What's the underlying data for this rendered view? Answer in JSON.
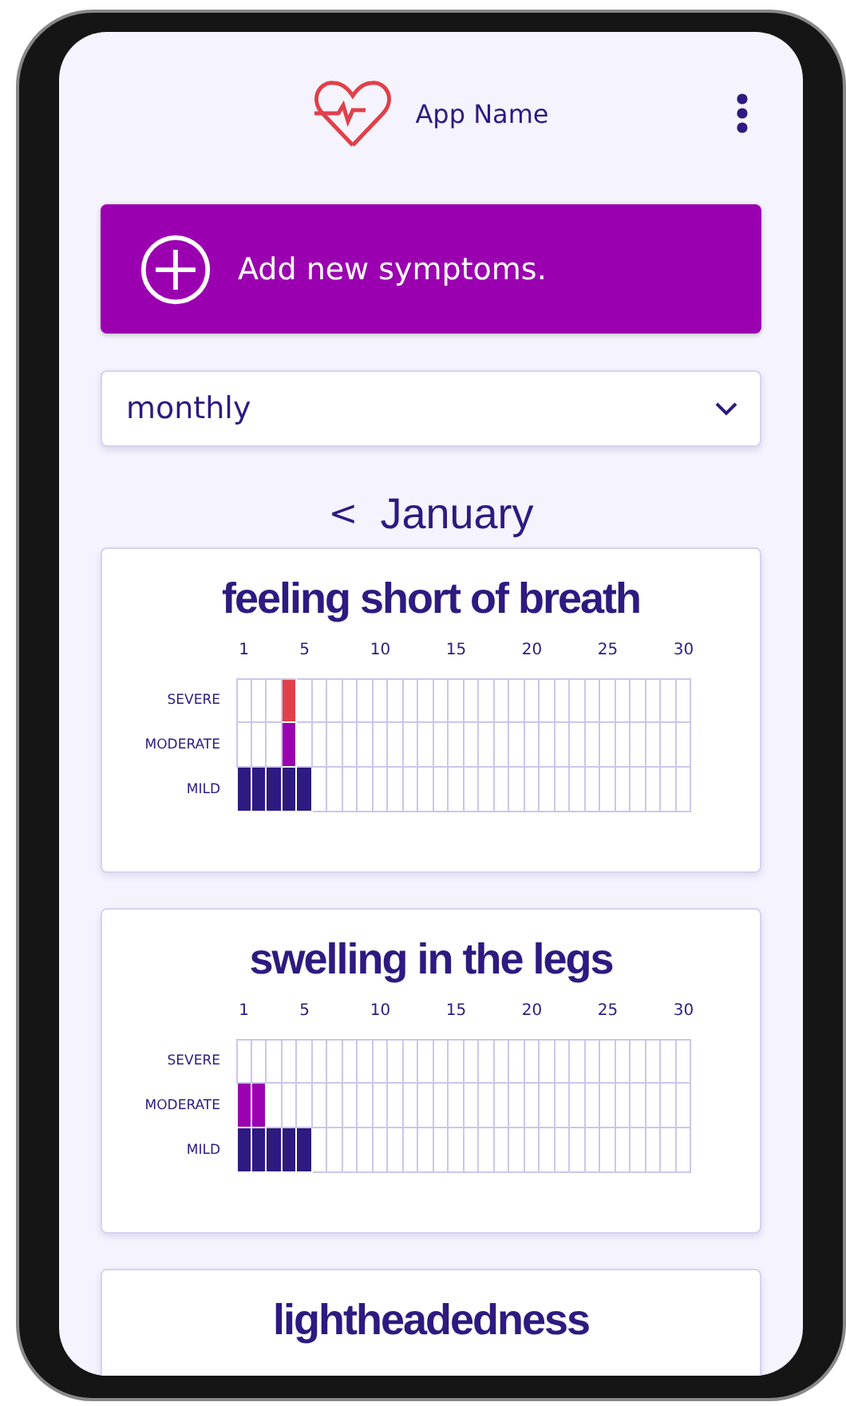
{
  "header": {
    "app_name": "App Name"
  },
  "add_button": {
    "label": "Add new symptoms."
  },
  "period_select": {
    "value": "monthly"
  },
  "month_nav": {
    "back": "<",
    "month": "January"
  },
  "cards": [
    {
      "title": "feeling short of breath",
      "ticks": [
        "1",
        "5",
        "10",
        "15",
        "20",
        "25",
        "30"
      ],
      "rows": [
        {
          "label": "SEVERE",
          "kind": "severe",
          "days": [
            false,
            false,
            false,
            true,
            false,
            false,
            false,
            false,
            false,
            false,
            false,
            false,
            false,
            false,
            false,
            false,
            false,
            false,
            false,
            false,
            false,
            false,
            false,
            false,
            false,
            false,
            false,
            false,
            false,
            false
          ]
        },
        {
          "label": "MODERATE",
          "kind": "moderate",
          "days": [
            false,
            false,
            false,
            true,
            false,
            false,
            false,
            false,
            false,
            false,
            false,
            false,
            false,
            false,
            false,
            false,
            false,
            false,
            false,
            false,
            false,
            false,
            false,
            false,
            false,
            false,
            false,
            false,
            false,
            false
          ]
        },
        {
          "label": "MILD",
          "kind": "mild",
          "days": [
            true,
            true,
            true,
            true,
            true,
            false,
            false,
            false,
            false,
            false,
            false,
            false,
            false,
            false,
            false,
            false,
            false,
            false,
            false,
            false,
            false,
            false,
            false,
            false,
            false,
            false,
            false,
            false,
            false,
            false
          ]
        }
      ]
    },
    {
      "title": "swelling in the legs",
      "ticks": [
        "1",
        "5",
        "10",
        "15",
        "20",
        "25",
        "30"
      ],
      "rows": [
        {
          "label": "SEVERE",
          "kind": "severe",
          "days": [
            false,
            false,
            false,
            false,
            false,
            false,
            false,
            false,
            false,
            false,
            false,
            false,
            false,
            false,
            false,
            false,
            false,
            false,
            false,
            false,
            false,
            false,
            false,
            false,
            false,
            false,
            false,
            false,
            false,
            false
          ]
        },
        {
          "label": "MODERATE",
          "kind": "moderate",
          "days": [
            true,
            true,
            false,
            false,
            false,
            false,
            false,
            false,
            false,
            false,
            false,
            false,
            false,
            false,
            false,
            false,
            false,
            false,
            false,
            false,
            false,
            false,
            false,
            false,
            false,
            false,
            false,
            false,
            false,
            false
          ]
        },
        {
          "label": "MILD",
          "kind": "mild",
          "days": [
            true,
            true,
            true,
            true,
            true,
            false,
            false,
            false,
            false,
            false,
            false,
            false,
            false,
            false,
            false,
            false,
            false,
            false,
            false,
            false,
            false,
            false,
            false,
            false,
            false,
            false,
            false,
            false,
            false,
            false
          ]
        }
      ]
    },
    {
      "title": "lightheadedness"
    }
  ]
}
